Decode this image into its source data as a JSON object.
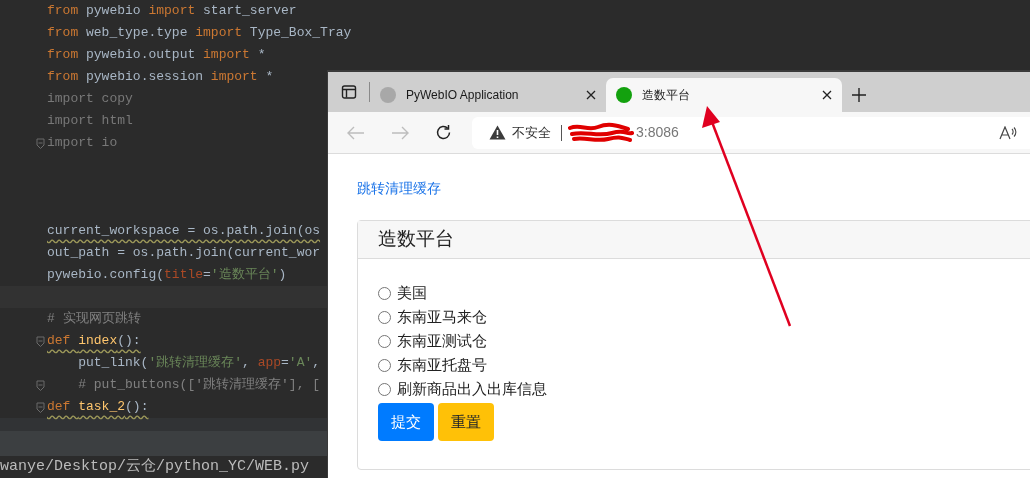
{
  "editor": {
    "lines": [
      {
        "kind": "code",
        "fold": false,
        "warning": false,
        "tokens": [
          {
            "kind": "kw",
            "text": "from"
          },
          {
            "kind": "id",
            "text": " pywebio "
          },
          {
            "kind": "kw",
            "text": "import"
          },
          {
            "kind": "id",
            "text": " start_server"
          }
        ]
      },
      {
        "kind": "code",
        "fold": false,
        "warning": false,
        "tokens": [
          {
            "kind": "kw",
            "text": "from"
          },
          {
            "kind": "id",
            "text": " web_type.type "
          },
          {
            "kind": "kw",
            "text": "import"
          },
          {
            "kind": "id",
            "text": " Type_Box_Tray"
          }
        ]
      },
      {
        "kind": "code",
        "fold": false,
        "warning": false,
        "tokens": [
          {
            "kind": "kw",
            "text": "from"
          },
          {
            "kind": "id",
            "text": " pywebio.output "
          },
          {
            "kind": "kw",
            "text": "import"
          },
          {
            "kind": "id",
            "text": " *"
          }
        ]
      },
      {
        "kind": "code",
        "fold": false,
        "warning": false,
        "tokens": [
          {
            "kind": "kw",
            "text": "from"
          },
          {
            "kind": "id",
            "text": " pywebio.session "
          },
          {
            "kind": "kw",
            "text": "import"
          },
          {
            "kind": "id",
            "text": " *"
          }
        ]
      },
      {
        "kind": "code",
        "fold": false,
        "warning": false,
        "tokens": [
          {
            "kind": "unused",
            "text": "import copy"
          }
        ]
      },
      {
        "kind": "code",
        "fold": false,
        "warning": false,
        "tokens": [
          {
            "kind": "unused",
            "text": "import html"
          }
        ]
      },
      {
        "kind": "code",
        "fold": true,
        "warning": false,
        "tokens": [
          {
            "kind": "unused",
            "text": "import io"
          }
        ]
      },
      {
        "kind": "blank"
      },
      {
        "kind": "blank"
      },
      {
        "kind": "blank"
      },
      {
        "kind": "code",
        "fold": false,
        "warning": true,
        "tokens": [
          {
            "kind": "id",
            "text": "current_workspace = os.path.join(os"
          }
        ]
      },
      {
        "kind": "code",
        "fold": false,
        "warning": false,
        "tokens": [
          {
            "kind": "id",
            "text": "out_path = os.path.join(current_wor"
          }
        ]
      },
      {
        "kind": "code",
        "fold": false,
        "warning": false,
        "tokens": [
          {
            "kind": "id",
            "text": "pywebio.config("
          },
          {
            "kind": "param",
            "text": "title"
          },
          {
            "kind": "id",
            "text": "="
          },
          {
            "kind": "str",
            "text": "'造数平台'"
          },
          {
            "kind": "id",
            "text": ")"
          }
        ]
      },
      {
        "kind": "current"
      },
      {
        "kind": "code",
        "fold": false,
        "warning": false,
        "tokens": [
          {
            "kind": "comment",
            "text": "# 实现网页跳转"
          }
        ]
      },
      {
        "kind": "code",
        "fold": true,
        "warning": true,
        "tokens": [
          {
            "kind": "kw",
            "text": "def "
          },
          {
            "kind": "fn",
            "text": "index"
          },
          {
            "kind": "id",
            "text": "():"
          }
        ]
      },
      {
        "kind": "code",
        "fold": false,
        "warning": false,
        "tokens": [
          {
            "kind": "id",
            "text": "    put_link("
          },
          {
            "kind": "str",
            "text": "'跳转清理缓存'"
          },
          {
            "kind": "id",
            "text": ", "
          },
          {
            "kind": "param",
            "text": "app"
          },
          {
            "kind": "id",
            "text": "="
          },
          {
            "kind": "str",
            "text": "'A'"
          },
          {
            "kind": "id",
            "text": ","
          }
        ]
      },
      {
        "kind": "code",
        "fold": true,
        "warning": false,
        "tokens": [
          {
            "kind": "comment",
            "text": "    # put_buttons(['跳转清理缓存'], ["
          }
        ]
      },
      {
        "kind": "code",
        "fold": true,
        "warning": true,
        "tokens": [
          {
            "kind": "kw",
            "text": "def "
          },
          {
            "kind": "fn",
            "text": "task_2"
          },
          {
            "kind": "id",
            "text": "():"
          }
        ]
      }
    ],
    "status_path": "wanye/Desktop/云仓/python_YC/WEB.py"
  },
  "browser": {
    "tabs": [
      {
        "title": "PyWebIO Application",
        "selected": false,
        "color": "#a8a8a8"
      },
      {
        "title": "造数平台",
        "selected": true,
        "color": "#13a10e"
      }
    ],
    "nav": {
      "back_disabled": true,
      "forward_disabled": true
    },
    "address": {
      "security": "不安全",
      "url": "3:8086"
    },
    "page": {
      "link": "跳转清理缓存",
      "card_title": "造数平台",
      "options": [
        {
          "label": "美国",
          "selected": false
        },
        {
          "label": "东南亚马来仓",
          "selected": false
        },
        {
          "label": "东南亚测试仓",
          "selected": false
        },
        {
          "label": "东南亚托盘号",
          "selected": false
        },
        {
          "label": "刷新商品出入出库信息",
          "selected": false
        }
      ],
      "buttons": [
        {
          "label": "提交",
          "kind": "primary"
        },
        {
          "label": "重置",
          "kind": "warning"
        }
      ]
    }
  }
}
